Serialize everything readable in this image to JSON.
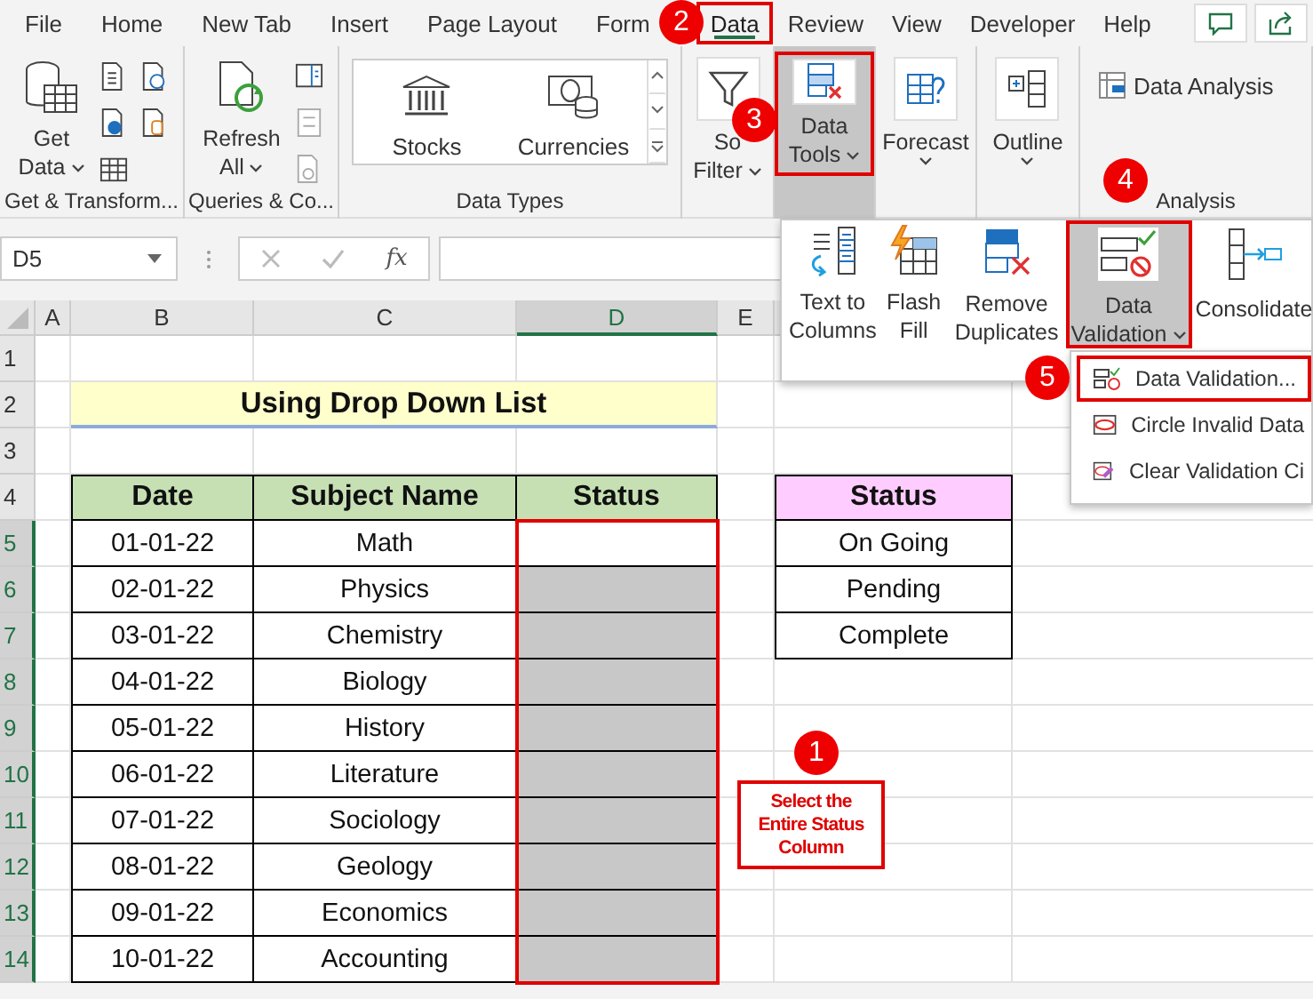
{
  "tabs": [
    {
      "label": "File",
      "selected": false,
      "outlined": false
    },
    {
      "label": "Home",
      "selected": false,
      "outlined": false
    },
    {
      "label": "New Tab",
      "selected": false,
      "outlined": false
    },
    {
      "label": "Insert",
      "selected": false,
      "outlined": false
    },
    {
      "label": "Page Layout",
      "selected": false,
      "outlined": false
    },
    {
      "label": "Form",
      "selected": false,
      "outlined": false
    },
    {
      "label": "Data",
      "selected": true,
      "outlined": true
    },
    {
      "label": "Review",
      "selected": false,
      "outlined": false
    },
    {
      "label": "View",
      "selected": false,
      "outlined": false
    },
    {
      "label": "Developer",
      "selected": false,
      "outlined": false
    },
    {
      "label": "Help",
      "selected": false,
      "outlined": false
    }
  ],
  "ribbon": {
    "groups": [
      {
        "kind": "large",
        "label": "Get & Transform...",
        "buttons": [
          {
            "lines": [
              "Get",
              "Data"
            ],
            "dropdown": true,
            "selected": false,
            "outlined": false
          }
        ]
      },
      {
        "kind": "large",
        "label": "Queries & Co...",
        "buttons": [
          {
            "lines": [
              "Refresh",
              "All"
            ],
            "dropdown": true,
            "selected": false,
            "outlined": false
          }
        ]
      },
      {
        "kind": "gallery",
        "label": "Data Types",
        "buttons": [
          {
            "lines": [
              "Stocks"
            ]
          },
          {
            "lines": [
              "Currencies"
            ]
          }
        ]
      },
      {
        "kind": "large",
        "buttons": [
          {
            "lines": [
              "So",
              "Filter"
            ],
            "dropdown": true,
            "selected": false,
            "outlined": false
          }
        ]
      },
      {
        "kind": "large",
        "buttons": [
          {
            "lines": [
              "Data",
              "Tools"
            ],
            "dropdown": true,
            "selected": true,
            "outlined": true
          }
        ]
      },
      {
        "kind": "large",
        "buttons": [
          {
            "lines": [
              "Forecast"
            ],
            "dropdown": true,
            "selected": false,
            "outlined": false
          }
        ]
      },
      {
        "kind": "large",
        "buttons": [
          {
            "lines": [
              "Outline"
            ],
            "dropdown": true,
            "selected": false,
            "outlined": false
          }
        ]
      },
      {
        "kind": "small",
        "label": "Analysis",
        "buttons": [
          {
            "lines": [
              "Data Analysis"
            ]
          }
        ]
      }
    ]
  },
  "formula_bar": {
    "name_box": "D5",
    "function_label": "fx"
  },
  "sheet": {
    "columns": [
      {
        "label": "A",
        "selected": false
      },
      {
        "label": "B",
        "selected": false
      },
      {
        "label": "C",
        "selected": false
      },
      {
        "label": "D",
        "selected": true
      },
      {
        "label": "E",
        "selected": false
      }
    ],
    "rows": [
      {
        "label": "1",
        "selected": false
      },
      {
        "label": "2",
        "selected": false
      },
      {
        "label": "3",
        "selected": false
      },
      {
        "label": "4",
        "selected": false
      },
      {
        "label": "5",
        "selected": true
      },
      {
        "label": "6",
        "selected": true
      },
      {
        "label": "7",
        "selected": true
      },
      {
        "label": "8",
        "selected": true
      },
      {
        "label": "9",
        "selected": true
      },
      {
        "label": "10",
        "selected": true
      },
      {
        "label": "11",
        "selected": true
      },
      {
        "label": "12",
        "selected": true
      },
      {
        "label": "13",
        "selected": true
      },
      {
        "label": "14",
        "selected": true
      }
    ],
    "title": "Using Drop Down List",
    "table": {
      "columns": [
        "Date",
        "Subject Name",
        "Status"
      ],
      "status_outlined": true,
      "rows": [
        {
          "date": "01-01-22",
          "subject": "Math",
          "selected": false
        },
        {
          "date": "02-01-22",
          "subject": "Physics",
          "selected": true
        },
        {
          "date": "03-01-22",
          "subject": "Chemistry",
          "selected": true
        },
        {
          "date": "04-01-22",
          "subject": "Biology",
          "selected": true
        },
        {
          "date": "05-01-22",
          "subject": "History",
          "selected": true
        },
        {
          "date": "06-01-22",
          "subject": "Literature",
          "selected": true
        },
        {
          "date": "07-01-22",
          "subject": "Sociology",
          "selected": true
        },
        {
          "date": "08-01-22",
          "subject": "Geology",
          "selected": true
        },
        {
          "date": "09-01-22",
          "subject": "Economics",
          "selected": true
        },
        {
          "date": "10-01-22",
          "subject": "Accounting",
          "selected": true
        }
      ]
    },
    "status_list": {
      "header": "Status",
      "items": [
        "On Going",
        "Pending",
        "Complete"
      ]
    }
  },
  "data_tools_menu": {
    "buttons": [
      {
        "lines": [
          "Text to",
          "Columns"
        ],
        "dropdown": false,
        "selected": false,
        "outlined": false
      },
      {
        "lines": [
          "Flash",
          "Fill"
        ],
        "dropdown": false,
        "selected": false,
        "outlined": false
      },
      {
        "lines": [
          "Remove",
          "Duplicates"
        ],
        "dropdown": false,
        "selected": false,
        "outlined": false
      },
      {
        "lines": [
          "Data",
          "Validation"
        ],
        "dropdown": true,
        "selected": true,
        "outlined": true
      },
      {
        "lines": [
          "Consolidate"
        ],
        "dropdown": false,
        "selected": false,
        "outlined": false
      }
    ],
    "items": [
      {
        "label": "Data Validation...",
        "outlined": true
      },
      {
        "label": "Circle Invalid Data",
        "outlined": false
      },
      {
        "label": "Clear Validation Ci",
        "outlined": false
      }
    ]
  },
  "callouts": [
    {
      "number": "1"
    },
    {
      "number": "2"
    },
    {
      "number": "3"
    },
    {
      "number": "4"
    },
    {
      "number": "5"
    }
  ],
  "note": "Select the Entire Status Column"
}
